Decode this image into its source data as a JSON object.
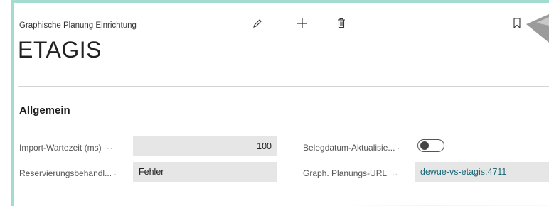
{
  "header": {
    "caption": "Graphische Planung Einrichtung",
    "title": "ETAGIS",
    "actions": [
      {
        "name": "edit-icon"
      },
      {
        "name": "new-icon"
      },
      {
        "name": "delete-icon"
      },
      {
        "name": "bookmark-icon"
      }
    ]
  },
  "section": {
    "title": "Allgemein"
  },
  "fields": {
    "import_wait": {
      "label": "Import-Wartezeit (ms)",
      "value": "100"
    },
    "reservation": {
      "label": "Reservierungsbehandl...",
      "value": "Fehler"
    },
    "date_update": {
      "label": "Belegdatum-Aktualisie...",
      "value": false
    },
    "planning_url": {
      "label": "Graph. Planungs-URL",
      "value": "dewue-vs-etagis:4711"
    }
  },
  "colors": {
    "accent_border": "#a3dccf",
    "link": "#1f6a78",
    "field_bg": "#e6e6e6"
  }
}
